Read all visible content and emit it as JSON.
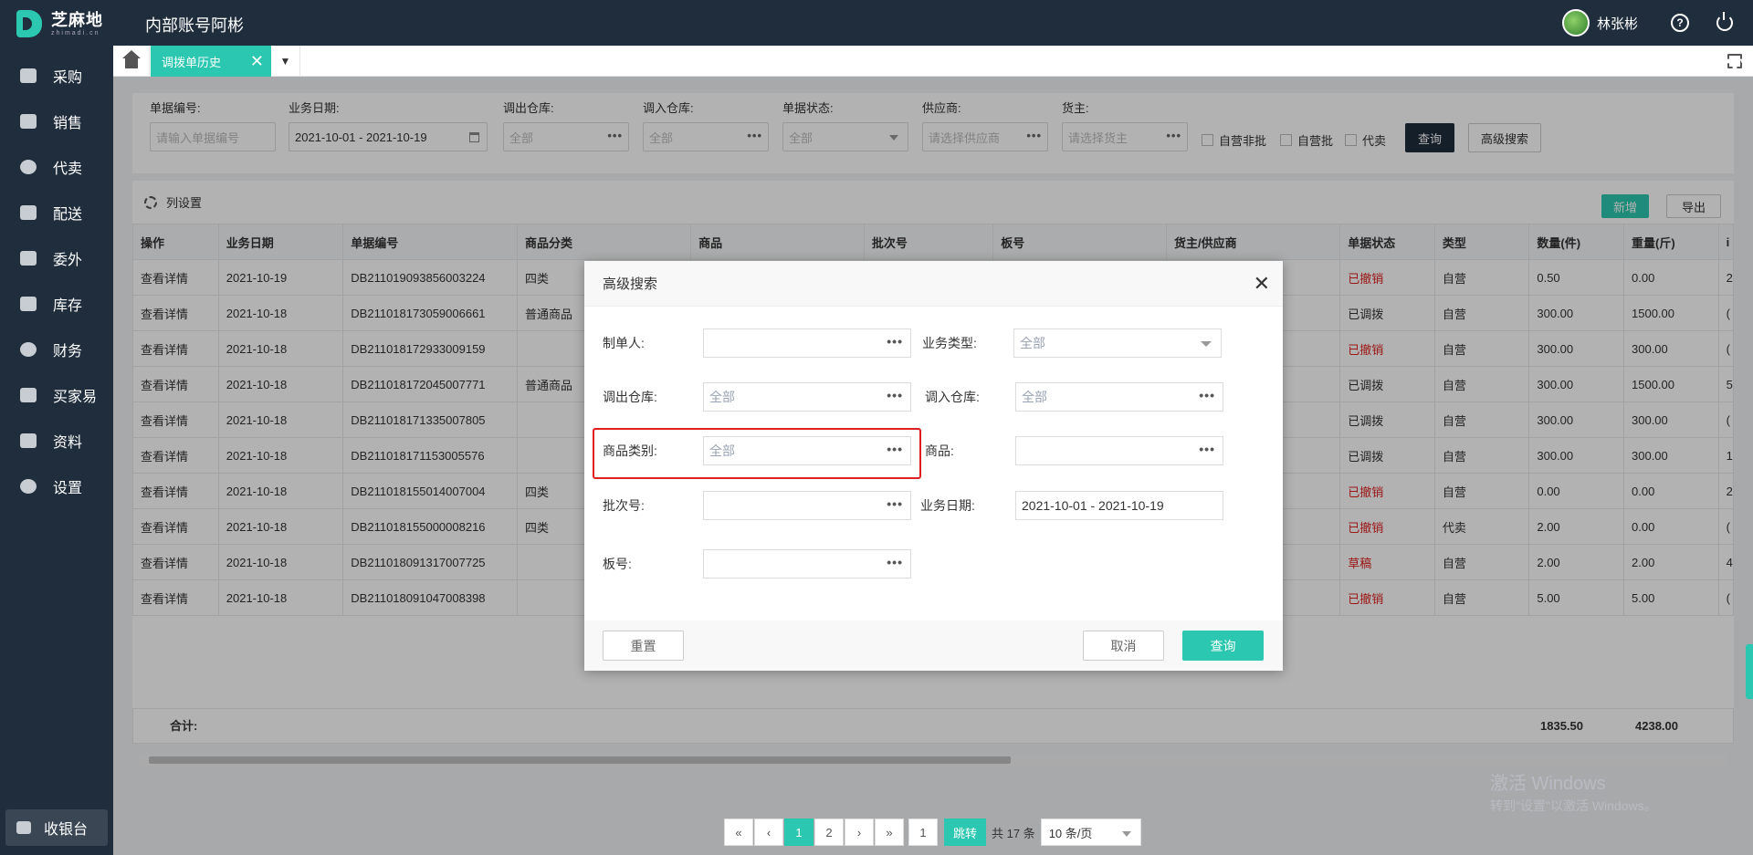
{
  "app": {
    "logo_cn": "芝麻地",
    "logo_en": "zhimadi.cn",
    "title": "内部账号阿彬",
    "user_name": "林张彬"
  },
  "sidebar": {
    "items": [
      {
        "label": "采购",
        "icon": "basket-icon"
      },
      {
        "label": "销售",
        "icon": "cart-icon"
      },
      {
        "label": "代卖",
        "icon": "tag-icon"
      },
      {
        "label": "配送",
        "icon": "truck-icon"
      },
      {
        "label": "委外",
        "icon": "building-icon"
      },
      {
        "label": "库存",
        "icon": "warehouse-icon"
      },
      {
        "label": "财务",
        "icon": "finance-icon"
      },
      {
        "label": "买家易",
        "icon": "shop-icon"
      },
      {
        "label": "资料",
        "icon": "print-icon"
      },
      {
        "label": "设置",
        "icon": "gear-icon"
      }
    ],
    "cashier_label": "收银台"
  },
  "tabs": {
    "active_label": "调拨单历史",
    "close": "✕",
    "dropdown": "▼"
  },
  "filters": {
    "doc_no": {
      "label": "单据编号:",
      "placeholder": "请输入单据编号"
    },
    "biz_date": {
      "label": "业务日期:",
      "value": "2021-10-01 - 2021-10-19"
    },
    "out_wh": {
      "label": "调出仓库:",
      "value": "全部"
    },
    "in_wh": {
      "label": "调入仓库:",
      "value": "全部"
    },
    "status": {
      "label": "单据状态:",
      "value": "全部"
    },
    "supplier": {
      "label": "供应商:",
      "placeholder": "请选择供应商"
    },
    "owner": {
      "label": "货主:",
      "placeholder": "请选择货主"
    },
    "checks": [
      "自营非批",
      "自营批",
      "代卖"
    ],
    "query_btn": "查询",
    "adv_btn": "高级搜索"
  },
  "toolbar": {
    "col_settings": "列设置",
    "add_btn": "新增",
    "export_btn": "导出"
  },
  "table": {
    "headers": [
      "操作",
      "业务日期",
      "单据编号",
      "商品分类",
      "商品",
      "批次号",
      "板号",
      "货主/供应商",
      "单据状态",
      "类型",
      "数量(件)",
      "重量(斤)",
      "i"
    ],
    "rows": [
      [
        "查看详情",
        "2021-10-19",
        "DB211019093856003224",
        "四类",
        "",
        "",
        "",
        "",
        "已撤销",
        "自营",
        "0.50",
        "0.00",
        "2"
      ],
      [
        "查看详情",
        "2021-10-18",
        "DB211018173059006661",
        "普通商品",
        "",
        "",
        "",
        "",
        "已调拨",
        "自营",
        "300.00",
        "1500.00",
        "("
      ],
      [
        "查看详情",
        "2021-10-18",
        "DB211018172933009159",
        "",
        "",
        "",
        "",
        "",
        "已撤销",
        "自营",
        "300.00",
        "300.00",
        "("
      ],
      [
        "查看详情",
        "2021-10-18",
        "DB211018172045007771",
        "普通商品",
        "",
        "",
        "",
        "",
        "已调拨",
        "自营",
        "300.00",
        "1500.00",
        "5"
      ],
      [
        "查看详情",
        "2021-10-18",
        "DB211018171335007805",
        "",
        "",
        "",
        "",
        "",
        "已调拨",
        "自营",
        "300.00",
        "300.00",
        "("
      ],
      [
        "查看详情",
        "2021-10-18",
        "DB211018171153005576",
        "",
        "",
        "",
        "",
        "",
        "已调拨",
        "自营",
        "300.00",
        "300.00",
        "1"
      ],
      [
        "查看详情",
        "2021-10-18",
        "DB211018155014007004",
        "四类",
        "",
        "",
        "",
        "",
        "已撤销",
        "自营",
        "0.00",
        "0.00",
        "2"
      ],
      [
        "查看详情",
        "2021-10-18",
        "DB211018155000008216",
        "四类",
        "",
        "",
        "",
        "",
        "已撤销",
        "代卖",
        "2.00",
        "0.00",
        "("
      ],
      [
        "查看详情",
        "2021-10-18",
        "DB211018091317007725",
        "",
        "",
        "",
        "",
        "",
        "草稿",
        "自营",
        "2.00",
        "2.00",
        "4"
      ],
      [
        "查看详情",
        "2021-10-18",
        "DB211018091047008398",
        "",
        "",
        "",
        "",
        "",
        "已撤销",
        "自营",
        "5.00",
        "5.00",
        "("
      ]
    ],
    "sum_label": "合计:",
    "sum_qty": "1835.50",
    "sum_weight": "4238.00"
  },
  "pagination": {
    "first": "«",
    "prev": "‹",
    "pages": [
      "1",
      "2"
    ],
    "next": "›",
    "last": "»",
    "jump_value": "1",
    "jump_btn": "跳转",
    "total": "共 17 条",
    "page_size": "10 条/页"
  },
  "watermark": {
    "line1": "激活 Windows",
    "line2": "转到\"设置\"以激活 Windows。"
  },
  "modal": {
    "title": "高级搜索",
    "close": "✕",
    "fields": {
      "creator": {
        "label": "制单人:",
        "value": ""
      },
      "biz_type": {
        "label": "业务类型:",
        "value": "全部"
      },
      "out_wh": {
        "label": "调出仓库:",
        "value": "全部"
      },
      "in_wh": {
        "label": "调入仓库:",
        "value": "全部"
      },
      "category": {
        "label": "商品类别:",
        "value": "全部"
      },
      "product": {
        "label": "商品:",
        "value": ""
      },
      "batch": {
        "label": "批次号:",
        "value": ""
      },
      "biz_date": {
        "label": "业务日期:",
        "value": "2021-10-01 - 2021-10-19"
      },
      "board": {
        "label": "板号:",
        "value": ""
      }
    },
    "dots": "•••",
    "reset_btn": "重置",
    "cancel_btn": "取消",
    "query_btn": "查询"
  },
  "colors": {
    "brand": "#2bc7b0",
    "dark": "#1f2d3d",
    "danger": "#e02020"
  }
}
